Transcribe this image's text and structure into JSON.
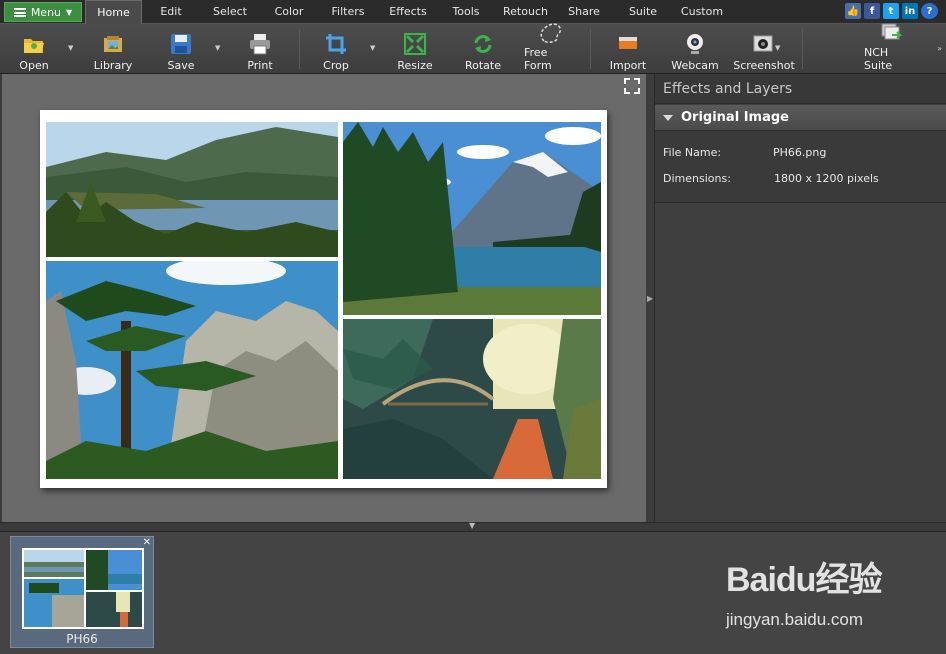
{
  "menubar": {
    "menu_label": "Menu",
    "tabs": [
      "Home",
      "Edit",
      "Select",
      "Color",
      "Filters",
      "Effects",
      "Tools",
      "Retouch",
      "Share",
      "Suite",
      "Custom"
    ],
    "active_tab": "Home",
    "social": [
      "like-icon",
      "facebook-icon",
      "twitter-icon",
      "linkedin-icon",
      "help-icon"
    ]
  },
  "toolbar": {
    "buttons": [
      {
        "label": "Open",
        "icon": "open-folder-icon",
        "dropdown": true
      },
      {
        "label": "Library",
        "icon": "library-icon",
        "dropdown": false
      },
      {
        "label": "Save",
        "icon": "save-icon",
        "dropdown": true
      },
      {
        "label": "Print",
        "icon": "print-icon",
        "dropdown": false
      },
      {
        "label": "Crop",
        "icon": "crop-icon",
        "dropdown": true
      },
      {
        "label": "Resize",
        "icon": "resize-icon",
        "dropdown": false
      },
      {
        "label": "Rotate",
        "icon": "rotate-icon",
        "dropdown": false
      },
      {
        "label": "Free Form",
        "icon": "free-form-icon",
        "dropdown": false
      },
      {
        "label": "Import",
        "icon": "import-icon",
        "dropdown": false
      },
      {
        "label": "Webcam",
        "icon": "webcam-icon",
        "dropdown": false
      },
      {
        "label": "Screenshot",
        "icon": "screenshot-icon",
        "dropdown": true
      },
      {
        "label": "NCH Suite",
        "icon": "nch-suite-icon",
        "dropdown": false
      }
    ]
  },
  "panel": {
    "title": "Effects and Layers",
    "section": "Original Image",
    "props": [
      {
        "label": "File Name:",
        "value": "PH66.png"
      },
      {
        "label": "Dimensions:",
        "value": "1800 x 1200 pixels"
      }
    ]
  },
  "thumbnails": [
    {
      "label": "PH66"
    }
  ],
  "watermark": {
    "brand": "Baidu经验",
    "url": "jingyan.baidu.com"
  },
  "colors": {
    "accent": "#3e8e41",
    "facebook": "#3b5998",
    "twitter": "#1da1f2",
    "linkedin": "#0077b5",
    "help": "#2a6fd0"
  }
}
